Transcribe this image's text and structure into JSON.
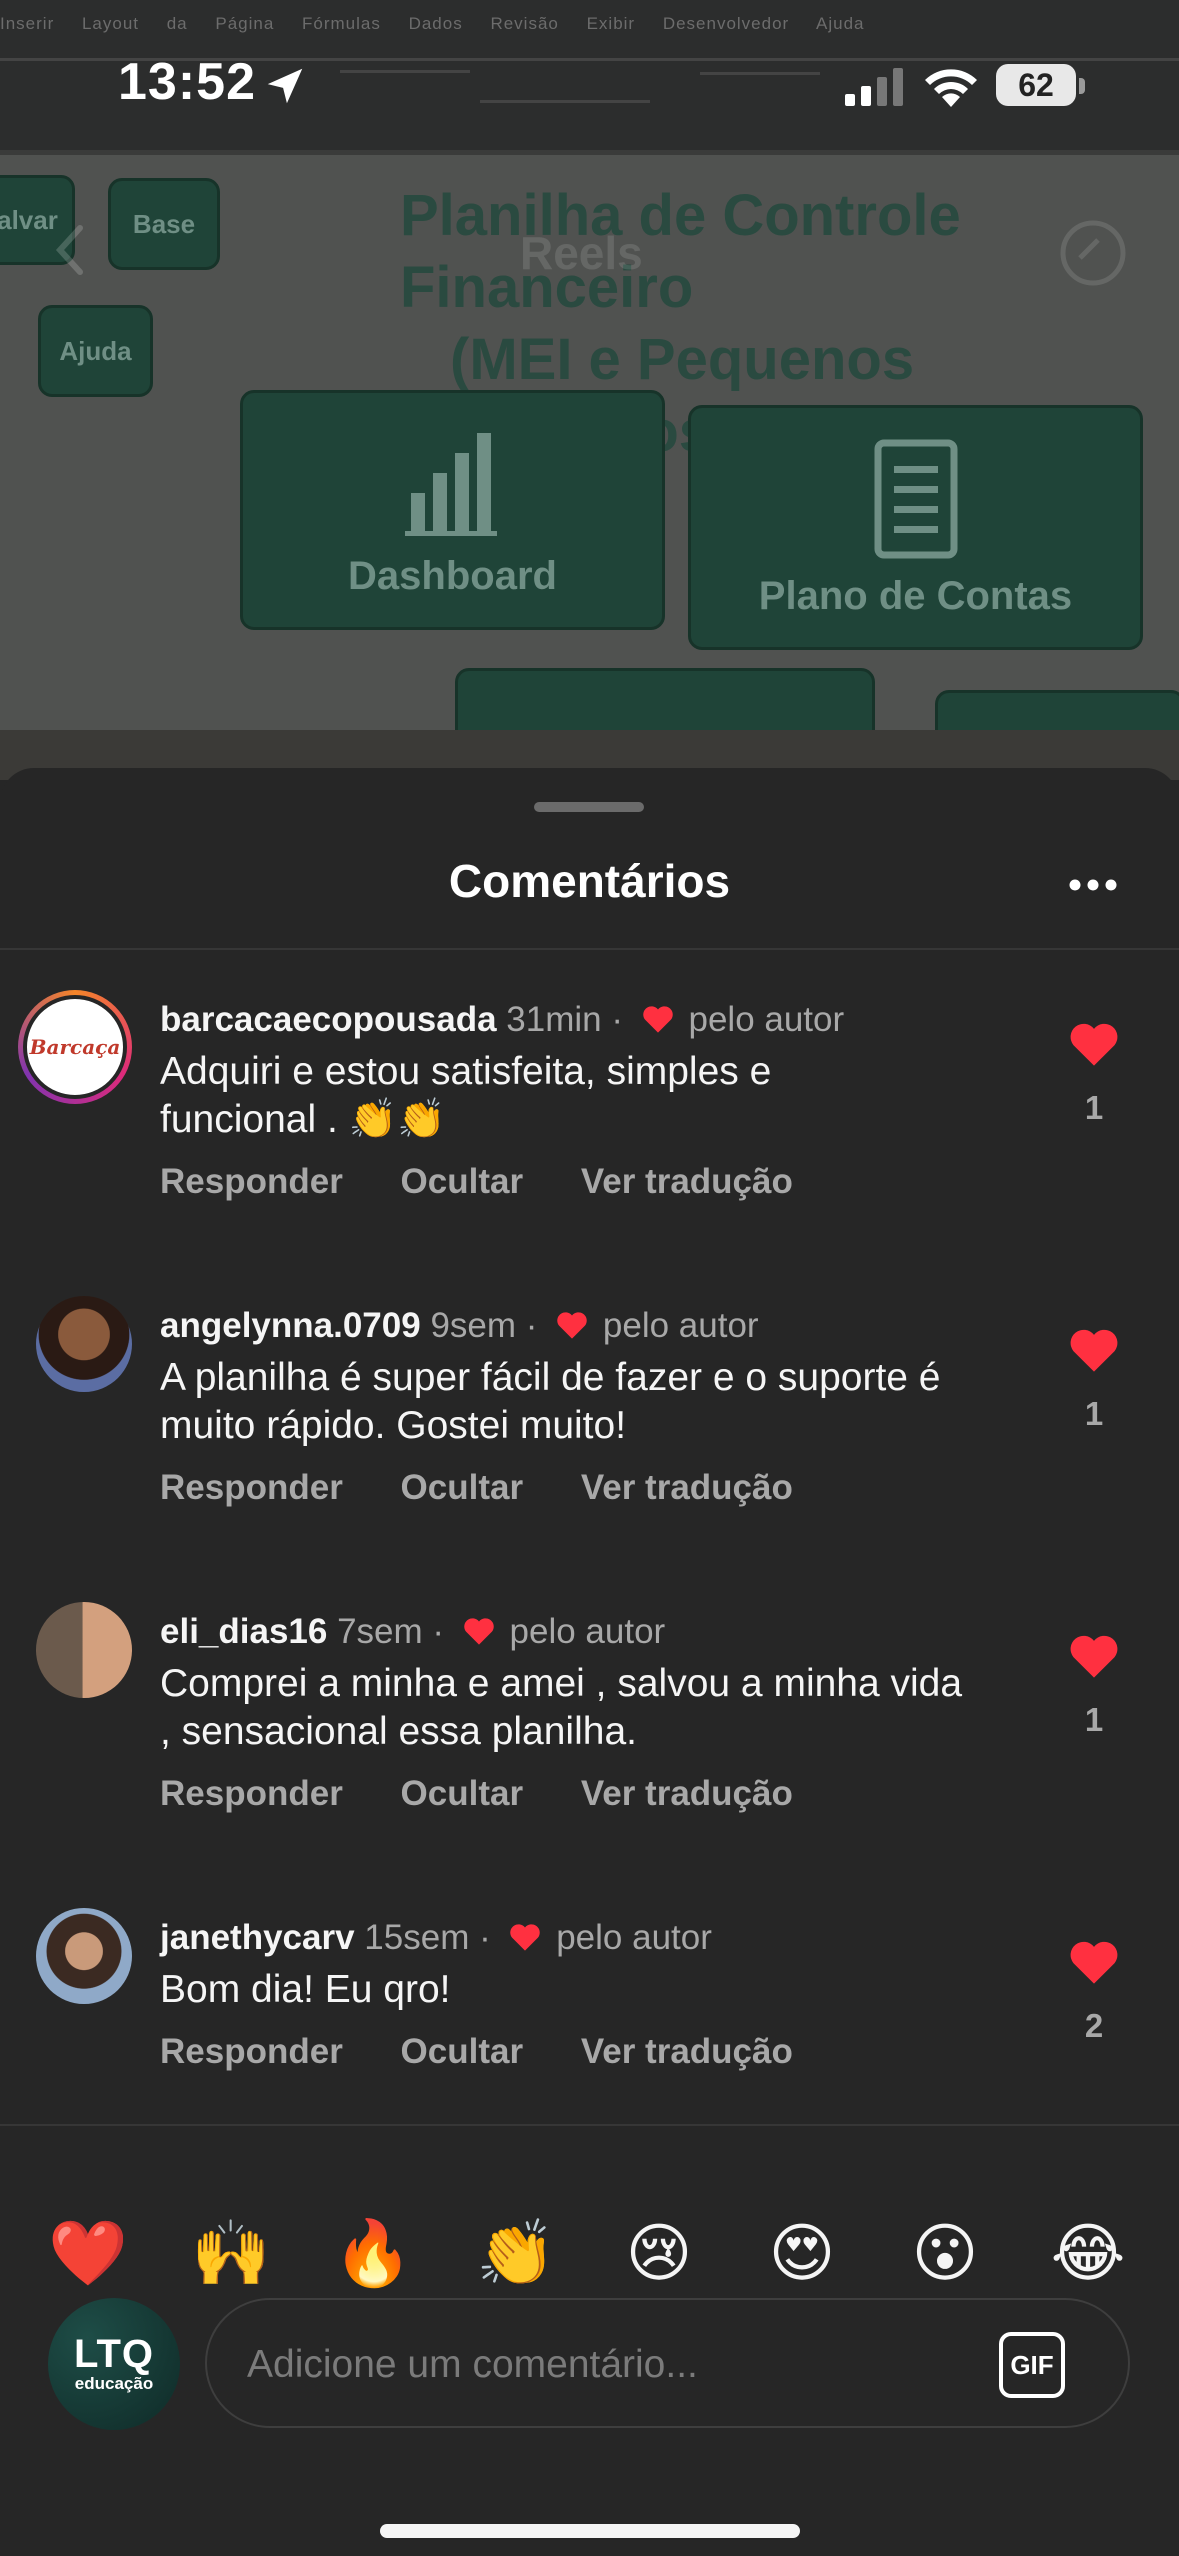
{
  "status_bar": {
    "time": "13:52",
    "battery": "62"
  },
  "reel_header": {
    "title": "Reels"
  },
  "background": {
    "ribbon_tabs": "Inserir Layout da Página Fórmulas Dados Revisão Exibir Desenvolvedor Ajuda",
    "sheet_title_line1": "Planilha de Controle Financeiro",
    "sheet_title_line2": "(MEI e Pequenos Negócios)",
    "buttons": {
      "salvar": "alvar",
      "base": "Base",
      "ajuda": "Ajuda",
      "dashboard": "Dashboard",
      "plano": "Plano de Contas"
    }
  },
  "panel": {
    "title": "Comentários"
  },
  "comments": [
    {
      "user": "barcacaecopousada",
      "time": "31min",
      "liked_by": "pelo autor",
      "text": "Adquiri e estou satisfeita, simples e funcional . 👏👏",
      "likes": "1",
      "avatar_text": "Barcaça"
    },
    {
      "user": "angelynna.0709",
      "time": "9sem",
      "liked_by": "pelo autor",
      "text": "A planilha é super fácil de fazer e o suporte é muito rápido. Gostei muito!",
      "likes": "1"
    },
    {
      "user": "eli_dias16",
      "time": "7sem",
      "liked_by": "pelo autor",
      "text": "Comprei a minha e amei , salvou a minha vida , sensacional essa planilha.",
      "likes": "1"
    },
    {
      "user": "janethycarv",
      "time": "15sem",
      "liked_by": "pelo autor",
      "text": "Bom dia! Eu qro!",
      "likes": "2"
    }
  ],
  "actions": {
    "reply": "Responder",
    "hide": "Ocultar",
    "translate": "Ver tradução"
  },
  "emojis": [
    "❤️",
    "🙌",
    "🔥",
    "👏",
    "😢",
    "😍",
    "😮",
    "😂"
  ],
  "composer": {
    "avatar_line1": "LTQ",
    "avatar_line2": "educação",
    "placeholder": "Adicione um comentário...",
    "gif_label": "GIF"
  },
  "colors": {
    "heart": "#ff3040",
    "background": "#262626",
    "muted": "#a8a8a8"
  }
}
